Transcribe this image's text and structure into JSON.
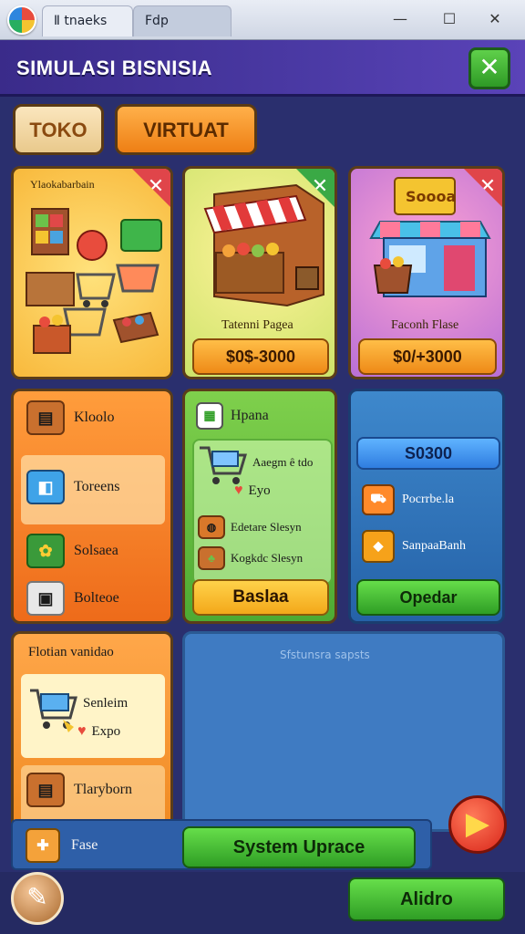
{
  "window": {
    "tabs": [
      "Ⅱ tnaeks",
      "Fdp"
    ],
    "controls": [
      "—",
      "☐",
      "✕"
    ]
  },
  "header": {
    "title": "SIMULASI BISNISIA",
    "close_symbol": "✕"
  },
  "mode_tabs": {
    "toko": "TOKO",
    "virtual": "VIRTUAT"
  },
  "cards": [
    {
      "label": "Ylaokabarbain",
      "corner": "✕",
      "corner_color": "#e0454a"
    },
    {
      "label": "Tatenni Pagea",
      "price": "$0$-3000",
      "corner": "✕",
      "corner_color": "#3aa945"
    },
    {
      "label": "Faconh Flase",
      "price": "$0/+3000",
      "corner": "✕",
      "corner_color": "#e0454a",
      "sign": "Soooa"
    }
  ],
  "orange_panel": {
    "items": [
      "Kloolo",
      "Toreens",
      "Solsaea",
      "Bolteoe"
    ]
  },
  "green_panel": {
    "title": "Hpana",
    "rows": [
      "Aaegm ê tdo",
      "Eyo",
      "Edetare Slesyn",
      "Kogkdc Slesyn"
    ],
    "button": "Baslaa"
  },
  "blue_panel": {
    "top_button": "S0300",
    "rows": [
      "Pocrrbe.la",
      "SanpaaBanh"
    ],
    "bottom_button": "Opedar"
  },
  "left_bottom_panel": {
    "title": "Flotian vanidao",
    "rows": [
      "Senleim",
      "Expo",
      "Tlaryborn"
    ]
  },
  "empty_panel": {
    "faint_text": "Sfstunsra sapsts"
  },
  "bottom_bar": {
    "fase_label": "Fase",
    "system_upgrade": "System Uprace"
  },
  "footer": {
    "main_button": "Alidro"
  },
  "icons": {
    "app": "app-logo-icon",
    "next": "play-arrow-icon",
    "tool": "brush-tool-icon"
  }
}
